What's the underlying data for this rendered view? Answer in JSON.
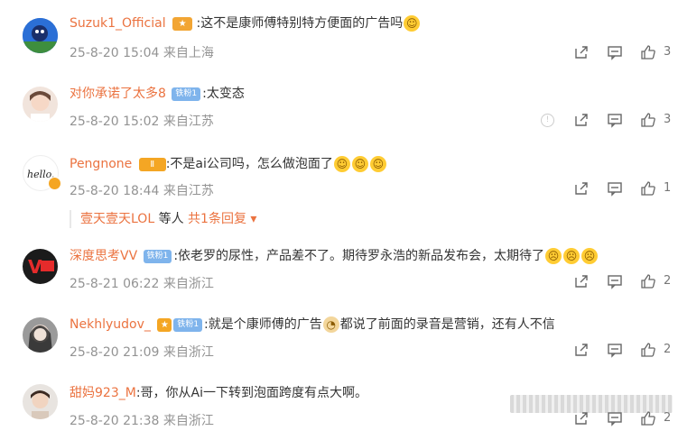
{
  "comments": [
    {
      "user": "Suzuk1_Official",
      "text": ":这不是康师傅特别特方便面的广告吗",
      "time": "25-8-20 15:04",
      "location": "来自上海",
      "likes": "3",
      "crown": "",
      "badge": "",
      "emojis": 1
    },
    {
      "user": "对你承诺了太多8",
      "text": ":太变态",
      "time": "25-8-20 15:02",
      "location": "来自江苏",
      "likes": "3",
      "crown": "",
      "badge": "铁粉1",
      "emojis": 0
    },
    {
      "user": "Pengnone",
      "text": ":不是ai公司吗，怎么做泡面了",
      "time": "25-8-20 18:44",
      "location": "来自江苏",
      "likes": "1",
      "crown": "Ⅱ",
      "badge": "",
      "emojis": 3
    },
    {
      "user": "深度思考VV",
      "text": ":依老罗的尿性，产品差不了。期待罗永浩的新品发布会，太期待了",
      "time": "25-8-21 06:22",
      "location": "来自浙江",
      "likes": "2",
      "crown": "",
      "badge": "铁粉1",
      "emojis": 3
    },
    {
      "user": "Nekhlyudov_",
      "text": ":就是个康师傅的广告",
      "text2": "都说了前面的录音是营销，还有人不信",
      "time": "25-8-20 21:09",
      "location": "来自浙江",
      "likes": "2",
      "crown": "",
      "badge": "铁粉1",
      "emojis": 0
    },
    {
      "user": "甜妈923_M",
      "text": ":哥，你从Ai一下转到泡面跨度有点大啊。",
      "time": "25-8-20 21:38",
      "location": "来自浙江",
      "likes": "2",
      "crown": "",
      "badge": "",
      "emojis": 0
    }
  ],
  "reply": {
    "user": "壹天壹天LOL",
    "mid": " 等人 ",
    "more": "共1条回复 ▾"
  },
  "colors": {
    "username": "#eb7340",
    "meta": "#939393",
    "text": "#333333"
  }
}
